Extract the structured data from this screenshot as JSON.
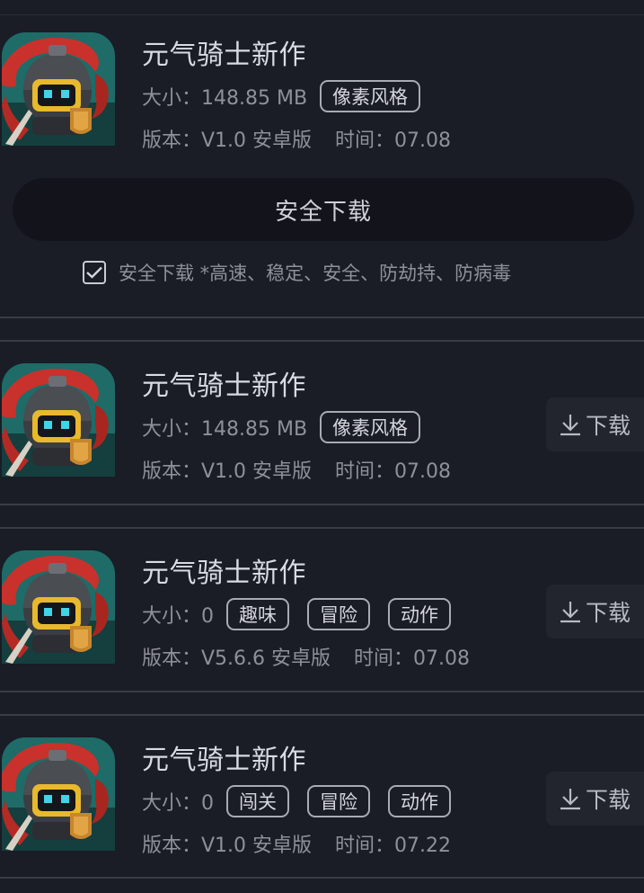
{
  "featured": {
    "title": "元气骑士新作",
    "size": "大小：148.85 MB",
    "tags": [
      "像素风格"
    ],
    "version": "版本：V1.0 安卓版",
    "time": "时间：07.08",
    "download_button": "安全下载",
    "safe_note": "安全下载 *高速、稳定、安全、防劫持、防病毒",
    "safe_checked": true
  },
  "list": [
    {
      "title": "元气骑士新作",
      "size": "大小：148.85 MB",
      "tags": [
        "像素风格"
      ],
      "version": "版本：V1.0 安卓版",
      "time": "时间：07.08",
      "download_label": "下载"
    },
    {
      "title": "元气骑士新作",
      "size": "大小：0",
      "tags": [
        "趣味",
        "冒险",
        "动作"
      ],
      "version": "版本：V5.6.6 安卓版",
      "time": "时间：07.08",
      "download_label": "下载"
    },
    {
      "title": "元气骑士新作",
      "size": "大小：0",
      "tags": [
        "闯关",
        "冒险",
        "动作"
      ],
      "version": "版本：V1.0 安卓版",
      "time": "时间：07.22",
      "download_label": "下载"
    }
  ],
  "colors": {
    "background": "#1a1c26",
    "button_bg": "#13141b",
    "tag_border": "#a9abb3"
  }
}
